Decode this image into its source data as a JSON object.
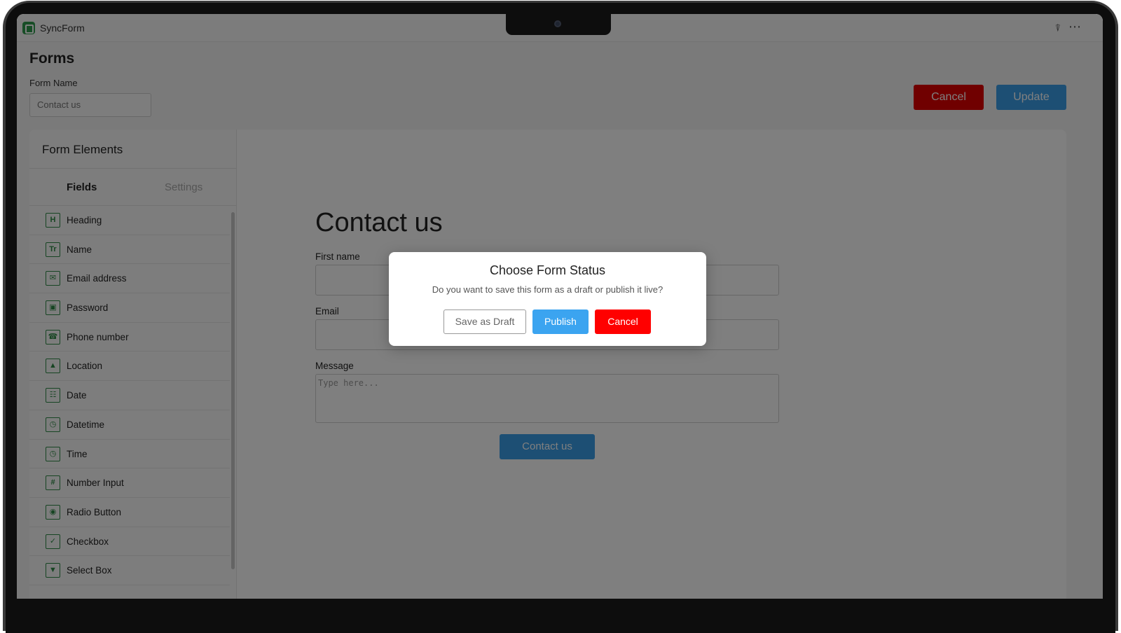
{
  "app": {
    "name": "SyncForm"
  },
  "page": {
    "title": "Forms"
  },
  "form_name": {
    "label": "Form Name",
    "value": "Contact us"
  },
  "header_buttons": {
    "cancel": "Cancel",
    "update": "Update"
  },
  "sidebar": {
    "title": "Form Elements",
    "tabs": [
      {
        "label": "Fields",
        "active": true
      },
      {
        "label": "Settings",
        "active": false
      }
    ],
    "fields": [
      {
        "label": "Heading",
        "icon": "heading-icon"
      },
      {
        "label": "Name",
        "icon": "text-icon"
      },
      {
        "label": "Email address",
        "icon": "email-icon"
      },
      {
        "label": "Password",
        "icon": "lock-icon"
      },
      {
        "label": "Phone number",
        "icon": "phone-icon"
      },
      {
        "label": "Location",
        "icon": "location-icon"
      },
      {
        "label": "Date",
        "icon": "calendar-icon"
      },
      {
        "label": "Datetime",
        "icon": "clock-icon"
      },
      {
        "label": "Time",
        "icon": "clock-icon"
      },
      {
        "label": "Number Input",
        "icon": "number-icon"
      },
      {
        "label": "Radio Button",
        "icon": "radio-icon"
      },
      {
        "label": "Checkbox",
        "icon": "checkbox-icon"
      },
      {
        "label": "Select Box",
        "icon": "select-icon"
      }
    ]
  },
  "form_preview": {
    "heading": "Contact us",
    "first_name_label": "First name",
    "email_label": "Email",
    "message_label": "Message",
    "message_placeholder": "Type here...",
    "submit_label": "Contact us"
  },
  "modal": {
    "title": "Choose Form Status",
    "message": "Do you want to save this form as a draft or publish it live?",
    "draft_label": "Save as Draft",
    "publish_label": "Publish",
    "cancel_label": "Cancel"
  },
  "colors": {
    "brand_green": "#2e9a4c",
    "primary_blue": "#3b9ee8",
    "danger_red": "#ff0000"
  }
}
